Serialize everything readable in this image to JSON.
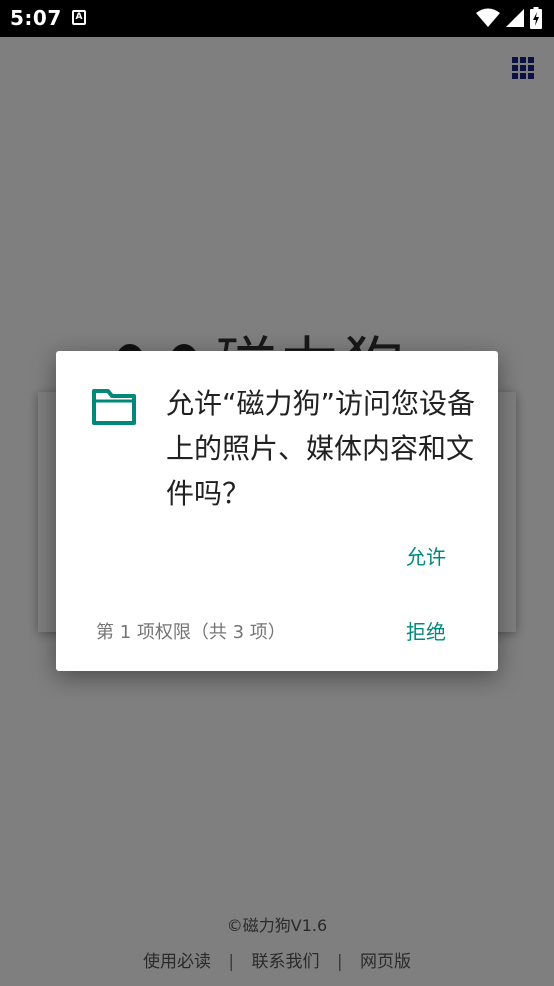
{
  "status_bar": {
    "time": "5:07",
    "notification_letter": "A",
    "icons": [
      "wifi-icon",
      "signal-icon",
      "battery-charging-icon"
    ]
  },
  "app": {
    "menu_icon": "grid-menu-icon",
    "logo_text": "磁力狗",
    "footer": {
      "copyright": "©磁力狗V1.6",
      "links": [
        "使用必读",
        "联系我们",
        "网页版"
      ],
      "separator": "|"
    }
  },
  "dialog": {
    "icon": "folder-icon",
    "title": "允许“磁力狗”访问您设备上的照片、媒体内容和文件吗？",
    "allow_label": "允许",
    "deny_label": "拒绝",
    "counter": "第 1 项权限（共 3 项）",
    "accent_color": "#00897b"
  }
}
